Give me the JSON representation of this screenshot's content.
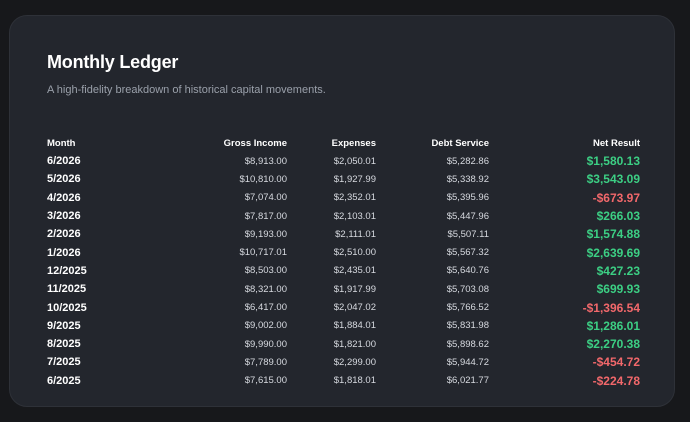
{
  "header": {
    "title": "Monthly Ledger",
    "subtitle": "A high-fidelity breakdown of historical capital movements."
  },
  "colors": {
    "positive": "#3ccf84",
    "negative": "#f2686b",
    "card_background": "#23262d",
    "page_background": "#17181b"
  },
  "table": {
    "columns": [
      "Month",
      "Gross Income",
      "Expenses",
      "Debt Service",
      "Net Result"
    ],
    "rows": [
      {
        "month": "6/2026",
        "gross": "$8,913.00",
        "expenses": "$2,050.01",
        "debt": "$5,282.86",
        "net": "$1,580.13",
        "sign": "pos"
      },
      {
        "month": "5/2026",
        "gross": "$10,810.00",
        "expenses": "$1,927.99",
        "debt": "$5,338.92",
        "net": "$3,543.09",
        "sign": "pos"
      },
      {
        "month": "4/2026",
        "gross": "$7,074.00",
        "expenses": "$2,352.01",
        "debt": "$5,395.96",
        "net": "-$673.97",
        "sign": "neg"
      },
      {
        "month": "3/2026",
        "gross": "$7,817.00",
        "expenses": "$2,103.01",
        "debt": "$5,447.96",
        "net": "$266.03",
        "sign": "pos"
      },
      {
        "month": "2/2026",
        "gross": "$9,193.00",
        "expenses": "$2,111.01",
        "debt": "$5,507.11",
        "net": "$1,574.88",
        "sign": "pos"
      },
      {
        "month": "1/2026",
        "gross": "$10,717.01",
        "expenses": "$2,510.00",
        "debt": "$5,567.32",
        "net": "$2,639.69",
        "sign": "pos"
      },
      {
        "month": "12/2025",
        "gross": "$8,503.00",
        "expenses": "$2,435.01",
        "debt": "$5,640.76",
        "net": "$427.23",
        "sign": "pos"
      },
      {
        "month": "11/2025",
        "gross": "$8,321.00",
        "expenses": "$1,917.99",
        "debt": "$5,703.08",
        "net": "$699.93",
        "sign": "pos"
      },
      {
        "month": "10/2025",
        "gross": "$6,417.00",
        "expenses": "$2,047.02",
        "debt": "$5,766.52",
        "net": "-$1,396.54",
        "sign": "neg"
      },
      {
        "month": "9/2025",
        "gross": "$9,002.00",
        "expenses": "$1,884.01",
        "debt": "$5,831.98",
        "net": "$1,286.01",
        "sign": "pos"
      },
      {
        "month": "8/2025",
        "gross": "$9,990.00",
        "expenses": "$1,821.00",
        "debt": "$5,898.62",
        "net": "$2,270.38",
        "sign": "pos"
      },
      {
        "month": "7/2025",
        "gross": "$7,789.00",
        "expenses": "$2,299.00",
        "debt": "$5,944.72",
        "net": "-$454.72",
        "sign": "neg"
      },
      {
        "month": "6/2025",
        "gross": "$7,615.00",
        "expenses": "$1,818.01",
        "debt": "$6,021.77",
        "net": "-$224.78",
        "sign": "neg"
      }
    ]
  }
}
